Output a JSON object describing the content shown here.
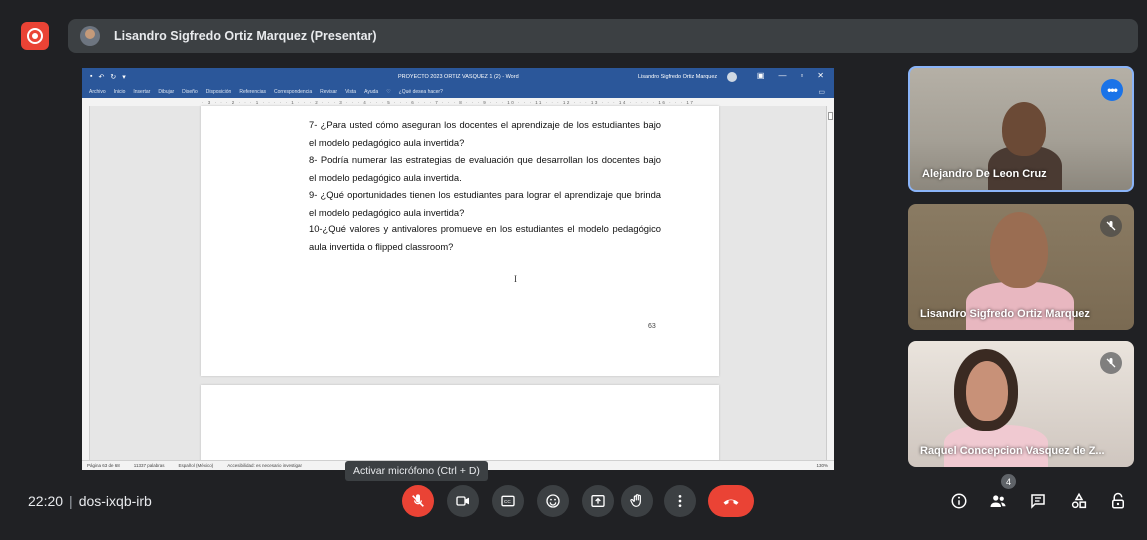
{
  "presenter": {
    "name": "Lisandro Sigfredo Ortiz Marquez (Presentar)"
  },
  "word": {
    "doc_title": "PROYECTO 2023 ORTIZ VASQUEZ 1 (2)  -  Word",
    "user_name": "Lisandro Sigfredo Ortiz Marquez",
    "menu": [
      "Archivo",
      "Inicio",
      "Insertar",
      "Dibujar",
      "Diseño",
      "Disposición",
      "Referencias",
      "Correspondencia",
      "Revisar",
      "Vista",
      "Ayuda",
      "¿Qué desea hacer?"
    ],
    "ruler_text": "· 3 · · · 2 · · · 1 · · · · · 1 · · · 2 · · · 3 · · · 4 · · · 5 · · · 6 · · · 7 · · · 8 · · · 9 · · · 10 · · · 11 · · · 12 · · · 13 · · · 14 · · · · · 16 · · · 17",
    "questions": [
      "7- ¿Para usted cómo aseguran los docentes el aprendizaje de los estudiantes bajo el modelo pedagógico aula invertida?",
      "8- Podría numerar las estrategias de evaluación que desarrollan los docentes bajo el modelo pedagógico aula invertida.",
      "9- ¿Qué oportunidades tienen los estudiantes para lograr el aprendizaje que brinda el modelo pedagógico aula invertida?",
      "10-¿Qué valores y antivalores promueve en los estudiantes el modelo pedagógico aula invertida o flipped classroom?"
    ],
    "page_number": "63",
    "status": {
      "page": "Página 63 de 68",
      "words": "11337 palabras",
      "language": "Español (México)",
      "accessibility": "Accesibilidad: es necesario investigar",
      "zoom": "130%"
    }
  },
  "tooltip": "Activar micrófono (Ctrl + D)",
  "participants": [
    {
      "name": "Alejandro De Leon Cruz"
    },
    {
      "name": "Lisandro Sigfredo Ortiz Marquez"
    },
    {
      "name": "Raquel Concepcion Vasquez de Z..."
    }
  ],
  "meeting": {
    "time": "22:20",
    "separator": "|",
    "code": "dos-ixqb-irb",
    "participant_count": "4"
  },
  "icons": {
    "more": "more-horiz-icon",
    "mic_off": "mic-off-icon",
    "camera": "videocam-icon",
    "captions": "closed-captions-icon",
    "emoji": "emoji-icon",
    "present": "present-screen-icon",
    "raise_hand": "raise-hand-icon",
    "more_options": "more-vert-icon",
    "end_call": "call-end-icon",
    "info": "info-icon",
    "people": "people-icon",
    "chat": "chat-icon",
    "activities": "activities-icon",
    "host_controls": "host-controls-icon"
  },
  "colors": {
    "meet_bg": "#202124",
    "control_bg": "#3c4043",
    "red": "#ea4335",
    "blue": "#1a73e8",
    "word_blue": "#2b579a"
  }
}
